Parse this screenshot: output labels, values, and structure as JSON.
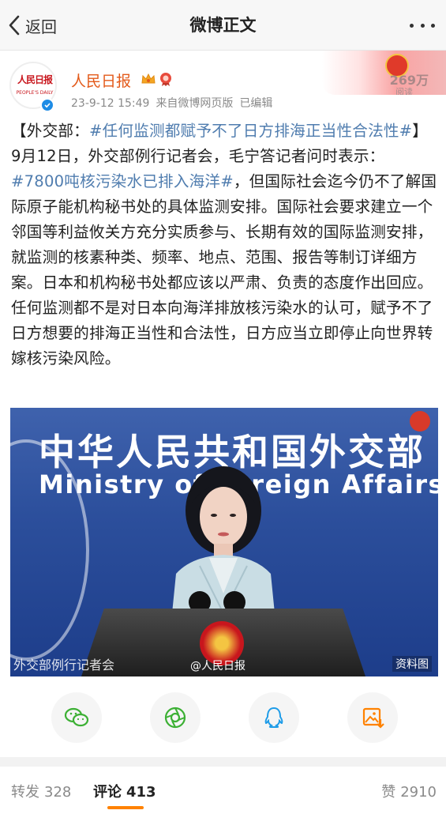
{
  "navbar": {
    "back_label": "返回",
    "title": "微博正文"
  },
  "post": {
    "avatar_text": "人民日报",
    "avatar_sub": "PEOPLE'S DAILY",
    "username": "人民日报",
    "date": "23-9-12 15:49",
    "source": "来自微博网页版",
    "edited": "已编辑",
    "read_count": "269万",
    "read_label": "阅读",
    "body": [
      {
        "type": "text",
        "value": "【外交部："
      },
      {
        "type": "hashtag",
        "value": "#任何监测都赋予不了日方排海正当性合法性#"
      },
      {
        "type": "text",
        "value": "】9月12日，外交部例行记者会，毛宁答记者问时表示："
      },
      {
        "type": "hashtag",
        "value": "#7800吨核污染水已排入海洋#"
      },
      {
        "type": "text",
        "value": "，但国际社会迄今仍不了解国际原子能机构秘书处的具体监测安排。国际社会要求建立一个邻国等利益攸关方充分实质参与、长期有效的国际监测安排，就监测的核素种类、频率、地点、范围、报告等制订详细方案。日本和机构秘书处都应该以严肃、负责的态度作出回应。任何监测都不是对日本向海洋排放核污染水的认可，赋予不了日方想要的排海正当性和合法性，日方应当立即停止向世界转嫁核污染风险。"
      }
    ],
    "photo": {
      "title_cn": "中华人民共和国外交部",
      "title_en": "Ministry of Foreign Affairs",
      "caption_left": "外交部例行记者会",
      "watermark": "@人民日报",
      "caption_right": "资料图"
    }
  },
  "share_buttons": [
    {
      "name": "wechat-icon",
      "color": "#3cb034"
    },
    {
      "name": "moments-icon",
      "color": "#3cb034"
    },
    {
      "name": "qq-icon",
      "color": "#1e9ce8"
    },
    {
      "name": "save-image-icon",
      "color": "#ff8200"
    }
  ],
  "tabs": {
    "repost_label": "转发",
    "repost_count": "328",
    "comment_label": "评论",
    "comment_count": "413",
    "like_label": "赞",
    "like_count": "2910"
  },
  "colors": {
    "hashtag": "#507daf",
    "username": "#e35a1a",
    "accent": "#ff8200"
  }
}
